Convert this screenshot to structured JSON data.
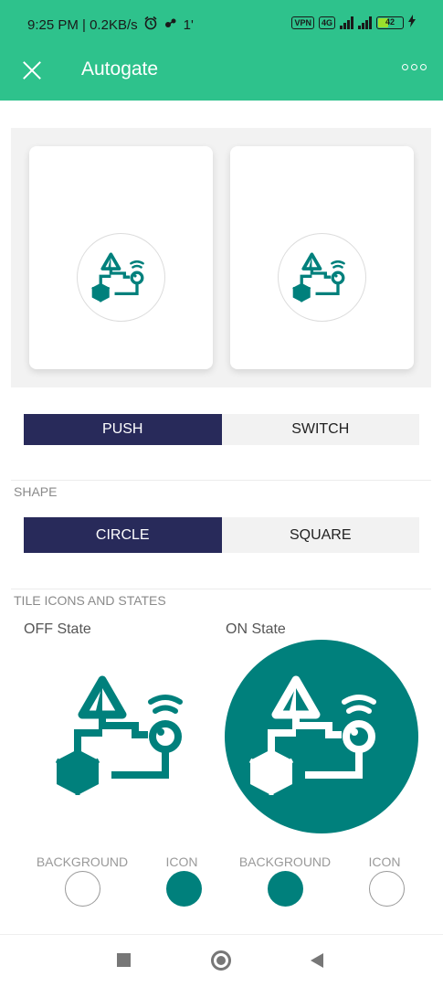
{
  "status_bar": {
    "time_speed": "9:25 PM | 0.2KB/s",
    "alarm_icon": "alarm-clock-icon",
    "extra_icon": "bluetooth-like-icon",
    "extra_text": "1'",
    "vpn": "VPN",
    "network_badge": "4G",
    "battery": "42",
    "battery_level": 0.42
  },
  "app_bar": {
    "title": "Autogate",
    "close_icon": "close-icon",
    "more_icon": "more-options-icon"
  },
  "preview": {
    "tile_icon": "iot-device-icon"
  },
  "mode": {
    "options": [
      "PUSH",
      "SWITCH"
    ],
    "selected": "PUSH"
  },
  "shape": {
    "label": "SHAPE",
    "options": [
      "CIRCLE",
      "SQUARE"
    ],
    "selected": "CIRCLE"
  },
  "tile_icons": {
    "label": "TILE ICONS AND STATES",
    "off_label": "OFF State",
    "on_label": "ON State"
  },
  "colors": {
    "off_background_label": "BACKGROUND",
    "off_icon_label": "ICON",
    "on_background_label": "BACKGROUND",
    "on_icon_label": "ICON",
    "off_background": "#ffffff",
    "off_icon": "#00807c",
    "on_background": "#00807c",
    "on_icon": "#ffffff",
    "accent": "#2ec28c",
    "active_segment": "#282a5a"
  }
}
